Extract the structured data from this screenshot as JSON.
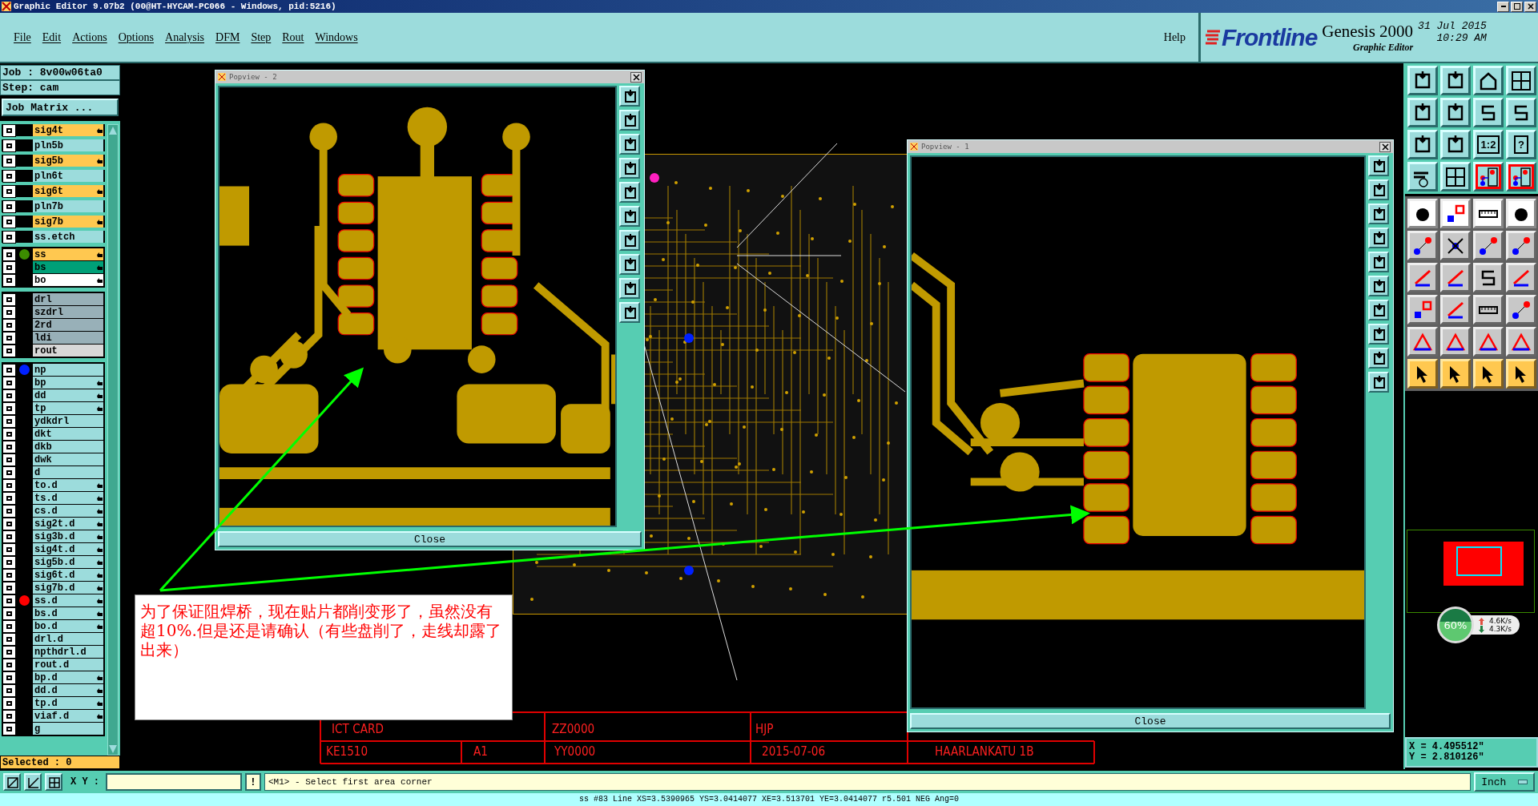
{
  "window": {
    "title": "Graphic Editor 9.07b2 (00@HT-HYCAM-PC066 - Windows, pid:5216)"
  },
  "menu": [
    "File",
    "Edit",
    "Actions",
    "Options",
    "Analysis",
    "DFM",
    "Step",
    "Rout",
    "Windows"
  ],
  "help": "Help",
  "brand": {
    "logo": "Frontline",
    "product": "Genesis 2000",
    "subtitle": "Graphic Editor",
    "date": "31 Jul 2015",
    "time": "10:29 AM"
  },
  "job": {
    "job": "Job : 8v00w06ta0",
    "step": "Step: cam",
    "matrix_button": "Job Matrix ..."
  },
  "layer_groups": [
    {
      "spaced": true,
      "layers": [
        {
          "name": "sig4t",
          "kind": "signal",
          "hand": true
        },
        {
          "name": "pln5b",
          "kind": "plane",
          "hand": false
        },
        {
          "name": "sig5b",
          "kind": "signal",
          "hand": true
        },
        {
          "name": "pln6t",
          "kind": "plane",
          "hand": false
        },
        {
          "name": "sig6t",
          "kind": "signal",
          "hand": true
        },
        {
          "name": "pln7b",
          "kind": "plane",
          "hand": false
        },
        {
          "name": "sig7b",
          "kind": "signal",
          "hand": true
        },
        {
          "name": "ss.etch",
          "kind": "plane",
          "hand": false
        }
      ]
    },
    {
      "spaced": false,
      "layers": [
        {
          "name": "ss",
          "kind": "signal",
          "hand": true,
          "color": "#3c8c00"
        },
        {
          "name": "bs",
          "kind": "solder",
          "hand": true
        },
        {
          "name": "bo",
          "kind": "silk",
          "hand": true
        }
      ]
    },
    {
      "spaced": false,
      "layers": [
        {
          "name": "drl",
          "kind": "drill",
          "hand": false
        },
        {
          "name": "szdrl",
          "kind": "drill",
          "hand": false
        },
        {
          "name": "2rd",
          "kind": "drill",
          "hand": false
        },
        {
          "name": "ldi",
          "kind": "drill",
          "hand": false
        },
        {
          "name": "rout",
          "kind": "rout",
          "hand": false
        }
      ]
    },
    {
      "spaced": false,
      "layers": [
        {
          "name": "np",
          "kind": "other",
          "hand": false,
          "color": "#0020ff"
        },
        {
          "name": "bp",
          "kind": "other",
          "hand": true
        },
        {
          "name": "dd",
          "kind": "other",
          "hand": true
        },
        {
          "name": "tp",
          "kind": "other",
          "hand": true
        },
        {
          "name": "ydkdrl",
          "kind": "other",
          "hand": false
        },
        {
          "name": "dkt",
          "kind": "other",
          "hand": false
        },
        {
          "name": "dkb",
          "kind": "other",
          "hand": false
        },
        {
          "name": "dwk",
          "kind": "other",
          "hand": false
        },
        {
          "name": "d",
          "kind": "other",
          "hand": false
        },
        {
          "name": "to.d",
          "kind": "other",
          "hand": true
        },
        {
          "name": "ts.d",
          "kind": "other",
          "hand": true
        },
        {
          "name": "cs.d",
          "kind": "other",
          "hand": true
        },
        {
          "name": "sig2t.d",
          "kind": "other",
          "hand": true
        },
        {
          "name": "sig3b.d",
          "kind": "other",
          "hand": true
        },
        {
          "name": "sig4t.d",
          "kind": "other",
          "hand": true
        },
        {
          "name": "sig5b.d",
          "kind": "other",
          "hand": true
        },
        {
          "name": "sig6t.d",
          "kind": "other",
          "hand": true
        },
        {
          "name": "sig7b.d",
          "kind": "other",
          "hand": true
        },
        {
          "name": "ss.d",
          "kind": "other",
          "hand": true,
          "color": "#ff0000"
        },
        {
          "name": "bs.d",
          "kind": "other",
          "hand": true
        },
        {
          "name": "bo.d",
          "kind": "other",
          "hand": true
        },
        {
          "name": "drl.d",
          "kind": "other",
          "hand": false
        },
        {
          "name": "npthdrl.d",
          "kind": "other",
          "hand": false
        },
        {
          "name": "rout.d",
          "kind": "other",
          "hand": false
        },
        {
          "name": "bp.d",
          "kind": "other",
          "hand": true
        },
        {
          "name": "dd.d",
          "kind": "other",
          "hand": true
        },
        {
          "name": "tp.d",
          "kind": "other",
          "hand": true
        },
        {
          "name": "viaf.d",
          "kind": "other",
          "hand": true
        },
        {
          "name": "g",
          "kind": "other",
          "hand": false
        }
      ]
    }
  ],
  "selected_count": "Selected : 0",
  "popviews": [
    {
      "title": "Popview - 2",
      "close": "Close",
      "kind": "ic-top"
    },
    {
      "title": "Popview - 1",
      "close": "Close",
      "kind": "ic-side"
    }
  ],
  "annotation": {
    "text": "为了保证阻焊桥，现在贴片都削变形了，虽然没有超10%.但是还是请确认（有些盘削了，走线却露了出来）"
  },
  "title_block": [
    "ICT CARD",
    "ZZ0000",
    "HJP",
    "KE1510",
    "A1",
    "YY0000",
    "2015-07-06",
    "HAARLANKATU 1B"
  ],
  "toolbox": {
    "groups": [
      {
        "tools": [
          {
            "kind": "teal",
            "highlighted": false
          },
          {
            "kind": "teal",
            "highlighted": false
          },
          {
            "kind": "teal",
            "highlighted": false
          },
          {
            "kind": "teal",
            "highlighted": false
          },
          {
            "kind": "teal",
            "highlighted": false
          },
          {
            "kind": "teal",
            "highlighted": false
          },
          {
            "kind": "teal",
            "highlighted": false
          },
          {
            "kind": "teal",
            "highlighted": false
          },
          {
            "kind": "teal",
            "highlighted": false
          },
          {
            "kind": "teal",
            "highlighted": false
          },
          {
            "kind": "teal",
            "highlighted": false,
            "label": "1:2"
          },
          {
            "kind": "teal",
            "highlighted": false,
            "label": "?"
          },
          {
            "kind": "teal",
            "highlighted": false
          },
          {
            "kind": "teal",
            "highlighted": false
          },
          {
            "kind": "teal",
            "highlighted": true
          },
          {
            "kind": "teal",
            "highlighted": true
          }
        ]
      },
      {
        "tools": [
          {
            "kind": "white",
            "highlighted": false
          },
          {
            "kind": "white",
            "highlighted": false
          },
          {
            "kind": "white",
            "highlighted": false
          },
          {
            "kind": "white",
            "highlighted": false
          },
          {
            "kind": "gray",
            "highlighted": false
          },
          {
            "kind": "gray",
            "highlighted": false
          },
          {
            "kind": "gray",
            "highlighted": false
          },
          {
            "kind": "gray",
            "highlighted": false
          },
          {
            "kind": "gray",
            "highlighted": false
          },
          {
            "kind": "gray",
            "highlighted": false
          },
          {
            "kind": "gray",
            "highlighted": false
          },
          {
            "kind": "gray",
            "highlighted": false
          },
          {
            "kind": "gray",
            "highlighted": false
          },
          {
            "kind": "gray",
            "highlighted": false
          },
          {
            "kind": "gray",
            "highlighted": false
          },
          {
            "kind": "gray",
            "highlighted": false
          },
          {
            "kind": "gray",
            "highlighted": false
          },
          {
            "kind": "gray",
            "highlighted": false
          },
          {
            "kind": "gray",
            "highlighted": false
          },
          {
            "kind": "gray",
            "highlighted": false
          },
          {
            "kind": "orange",
            "highlighted": false
          },
          {
            "kind": "orange",
            "highlighted": false
          },
          {
            "kind": "orange",
            "highlighted": false
          },
          {
            "kind": "orange",
            "highlighted": false
          }
        ]
      }
    ]
  },
  "network_widget": {
    "percent": "60%",
    "upload": "4.6K/s",
    "download": "4.3K/s"
  },
  "coordinates": {
    "x": "X = 4.495512\"",
    "y": "Y = 2.810126\""
  },
  "command_bar": {
    "xy_label": "X Y :",
    "bang": "!",
    "message": "<M1> - Select first area corner",
    "units": "Inch"
  },
  "status_line": "ss #83 Line XS=3.5390965 YS=3.0414077 XE=3.513701 YE=3.0414077 r5.501 NEG Ang=0"
}
